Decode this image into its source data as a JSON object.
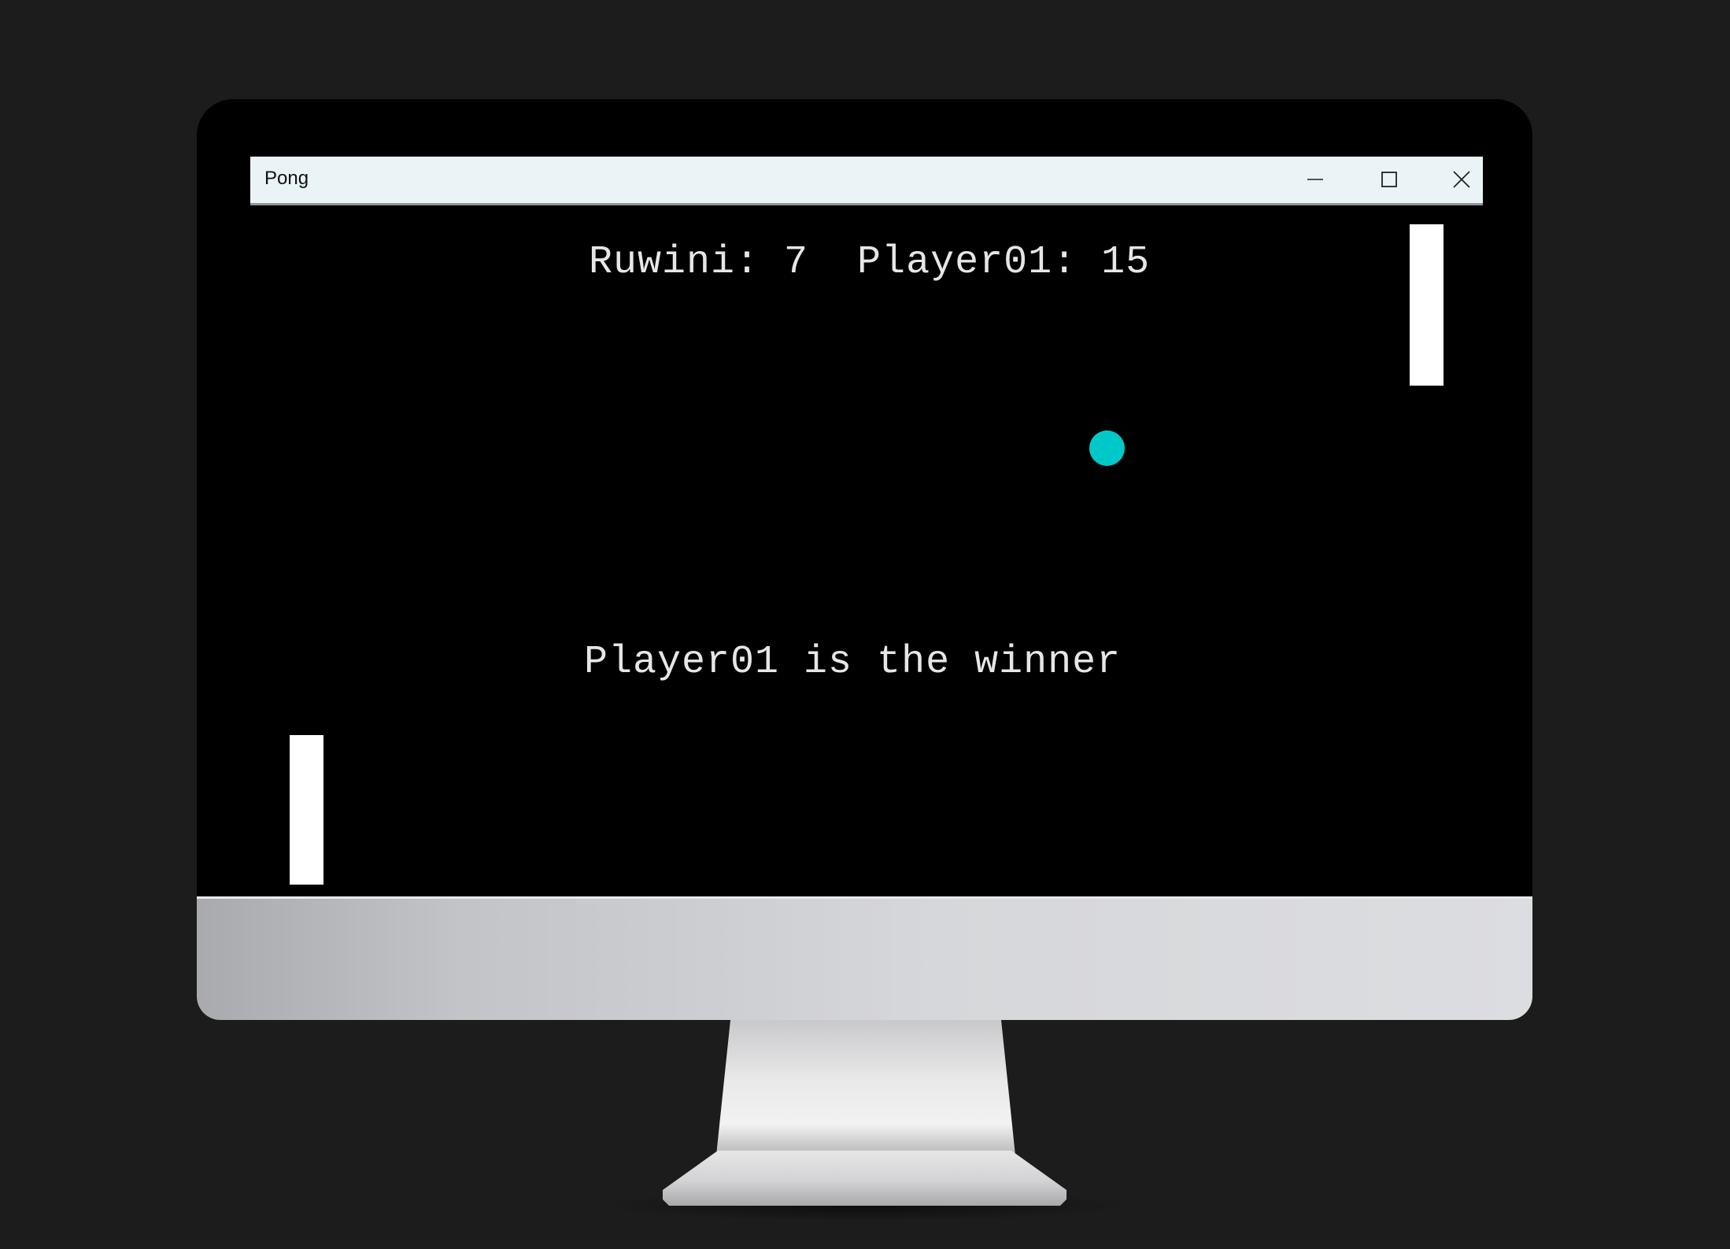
{
  "window": {
    "title": "Pong"
  },
  "scoreboard": {
    "player1_name": "Ruwini",
    "player1_score": "7",
    "player2_name": "Player01",
    "player2_score": "15",
    "text": "Ruwini: 7  Player01: 15"
  },
  "game": {
    "winner_message": "Player01 is the winner"
  },
  "colors": {
    "ball": "#00c8c8",
    "paddles": "#ffffff",
    "canvas": "#000000",
    "title_bar": "#eaf4f6"
  },
  "icons": {
    "minimize": "minimize-icon",
    "maximize": "maximize-icon",
    "close": "close-icon"
  }
}
